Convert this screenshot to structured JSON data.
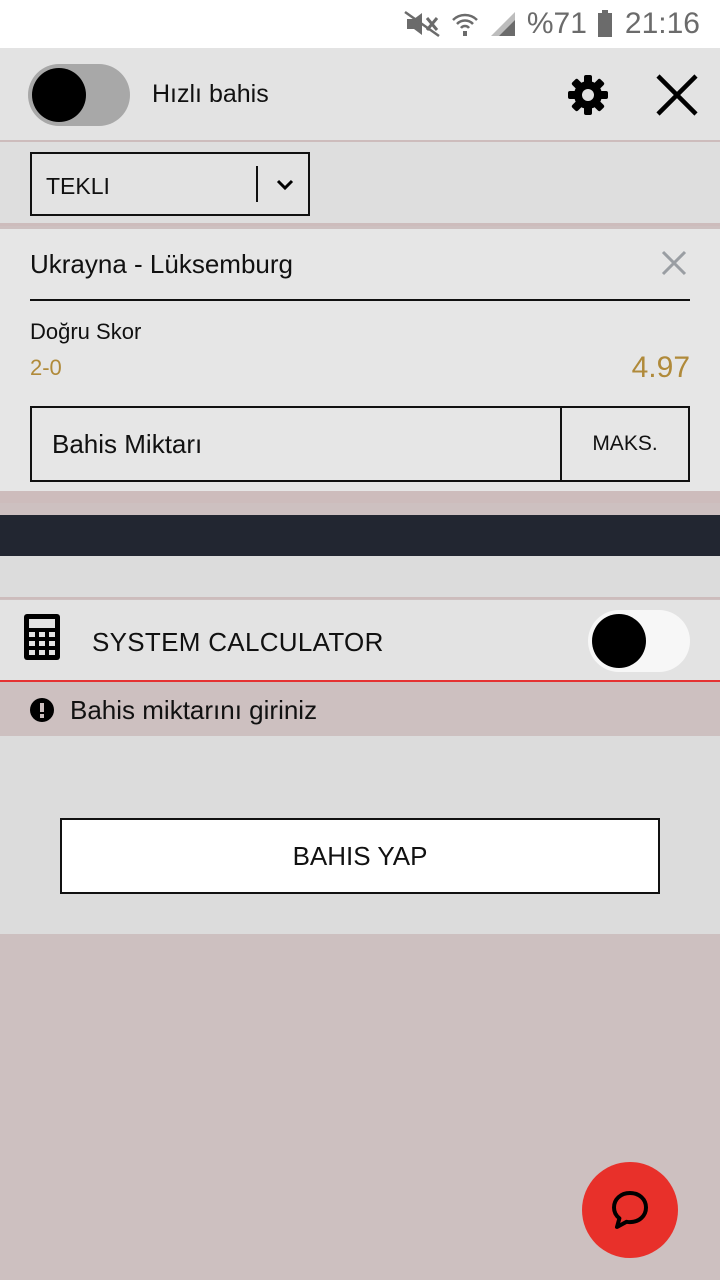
{
  "status_bar": {
    "battery": "%71",
    "time": "21:16",
    "icons": [
      "mute-icon",
      "wifi-icon",
      "signal-icon",
      "battery-icon"
    ]
  },
  "top_bar": {
    "quick_bet_label": "Hızlı bahis",
    "quick_bet_enabled": false,
    "settings_icon": "gear-icon",
    "close_icon": "close-icon"
  },
  "bet_type": {
    "selected": "TEKLI"
  },
  "bet": {
    "match": "Ukrayna - Lüksemburg",
    "market": "Doğru Skor",
    "selection": "2-0",
    "odds": "4.97",
    "stake_placeholder": "Bahis Miktarı",
    "max_label": "MAKS."
  },
  "system_calculator": {
    "label": "SYSTEM CALCULATOR",
    "enabled": false
  },
  "warning": {
    "text": "Bahis miktarını giriniz"
  },
  "place_bet": {
    "label": "BAHIS YAP"
  },
  "colors": {
    "accent_odds": "#b08a3a",
    "fab_red": "#e8302a",
    "dark_band": "#222631",
    "error_line": "#e53232"
  }
}
